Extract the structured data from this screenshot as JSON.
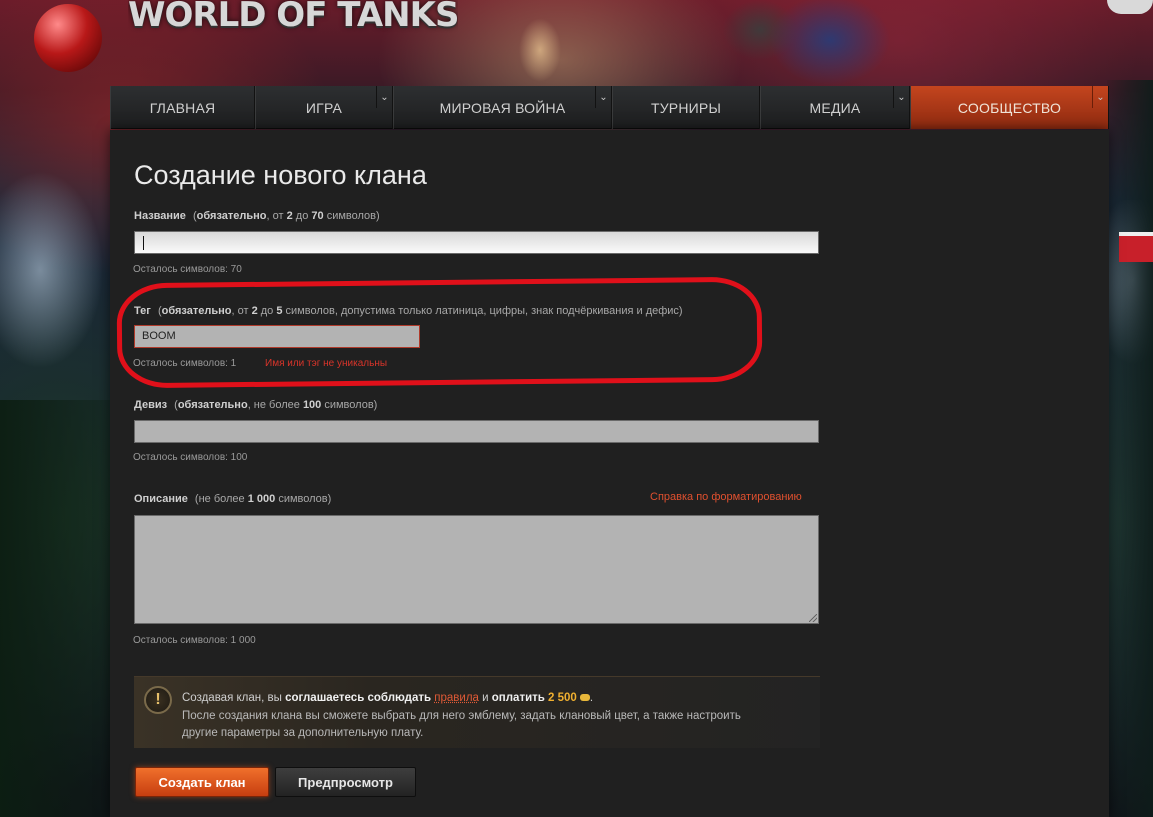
{
  "header": {
    "logo_text": "WORLD OF TANKS"
  },
  "nav": {
    "items": [
      {
        "label": "ГЛАВНАЯ",
        "has_dropdown": false,
        "active": false
      },
      {
        "label": "ИГРА",
        "has_dropdown": true,
        "active": false
      },
      {
        "label": "МИРОВАЯ ВОЙНА",
        "has_dropdown": true,
        "active": false
      },
      {
        "label": "ТУРНИРЫ",
        "has_dropdown": false,
        "active": false
      },
      {
        "label": "МЕДИА",
        "has_dropdown": true,
        "active": false
      },
      {
        "label": "СООБЩЕСТВО",
        "has_dropdown": true,
        "active": true
      }
    ],
    "dropdown_icon": "chevron-down-icon",
    "active_color": "#c4451e"
  },
  "form": {
    "title": "Создание нового клана",
    "name": {
      "label": "Название",
      "hint_pre": "(",
      "hint_required": "обязательно",
      "hint_mid1": ", от ",
      "hint_min": "2",
      "hint_mid2": " до ",
      "hint_max": "70",
      "hint_post": " символов)",
      "value": "",
      "counter": "Осталось символов: 70"
    },
    "tag": {
      "label": "Тег",
      "hint_pre": "(",
      "hint_required": "обязательно",
      "hint_mid1": ", от ",
      "hint_min": "2",
      "hint_mid2": " до ",
      "hint_max": "5",
      "hint_post": " символов, допустима только латиница, цифры, знак подчёркивания и дефис)",
      "value": "BOOM",
      "counter": "Осталось символов: 1",
      "error": "Имя или тэг не уникальны"
    },
    "motto": {
      "label": "Девиз",
      "hint_pre": "(",
      "hint_required": "обязательно",
      "hint_mid1": ", не более ",
      "hint_max": "100",
      "hint_post": " символов)",
      "value": "",
      "counter": "Осталось символов: 100"
    },
    "description": {
      "label": "Описание",
      "hint_pre": "(не более ",
      "hint_max": "1 000",
      "hint_post": " символов)",
      "value": "",
      "counter": "Осталось символов: 1 000",
      "format_help_link": "Справка по форматированию"
    }
  },
  "notice": {
    "icon": "exclamation-icon",
    "line1_pre": "Создавая клан, вы ",
    "line1_strong1": "соглашаетесь соблюдать",
    "line1_space": " ",
    "line1_rules": "правила",
    "line1_and": " и ",
    "line1_strong2": "оплатить",
    "line1_price": " 2 500",
    "line1_end": ".",
    "currency_icon": "gold-coin-icon",
    "line2": "После создания клана вы сможете выбрать для него эмблему, задать клановый цвет, а также настроить",
    "line3": "другие параметры за дополнительную плату."
  },
  "buttons": {
    "create": "Создать клан",
    "preview": "Предпросмотр"
  },
  "colors": {
    "accent_orange": "#e0502f",
    "error_red": "#d8342a",
    "annotation_red": "#e0101a",
    "gold": "#f0b030"
  }
}
